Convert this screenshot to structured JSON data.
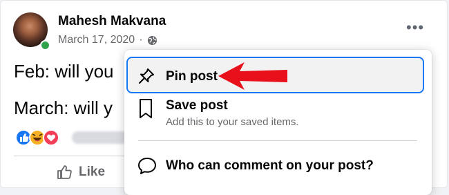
{
  "post": {
    "author": "Mahesh Makvana",
    "date": "March 17, 2020",
    "date_separator": "·",
    "lines": [
      "Feb: will you",
      "March: will y"
    ],
    "like_label": "Like"
  },
  "menu": {
    "items": [
      {
        "label": "Pin post",
        "sublabel": "",
        "icon": "pin-icon",
        "highlighted": true
      },
      {
        "label": "Save post",
        "sublabel": "Add this to your saved items.",
        "icon": "bookmark-icon"
      },
      {
        "label": "Who can comment on your post?",
        "sublabel": "",
        "icon": "comment-icon"
      }
    ]
  },
  "reactions": [
    "like",
    "haha",
    "love"
  ],
  "colors": {
    "highlight_border": "#1877f2",
    "online": "#31a24c",
    "arrow": "#e8101a",
    "muted_text": "#65676b"
  }
}
